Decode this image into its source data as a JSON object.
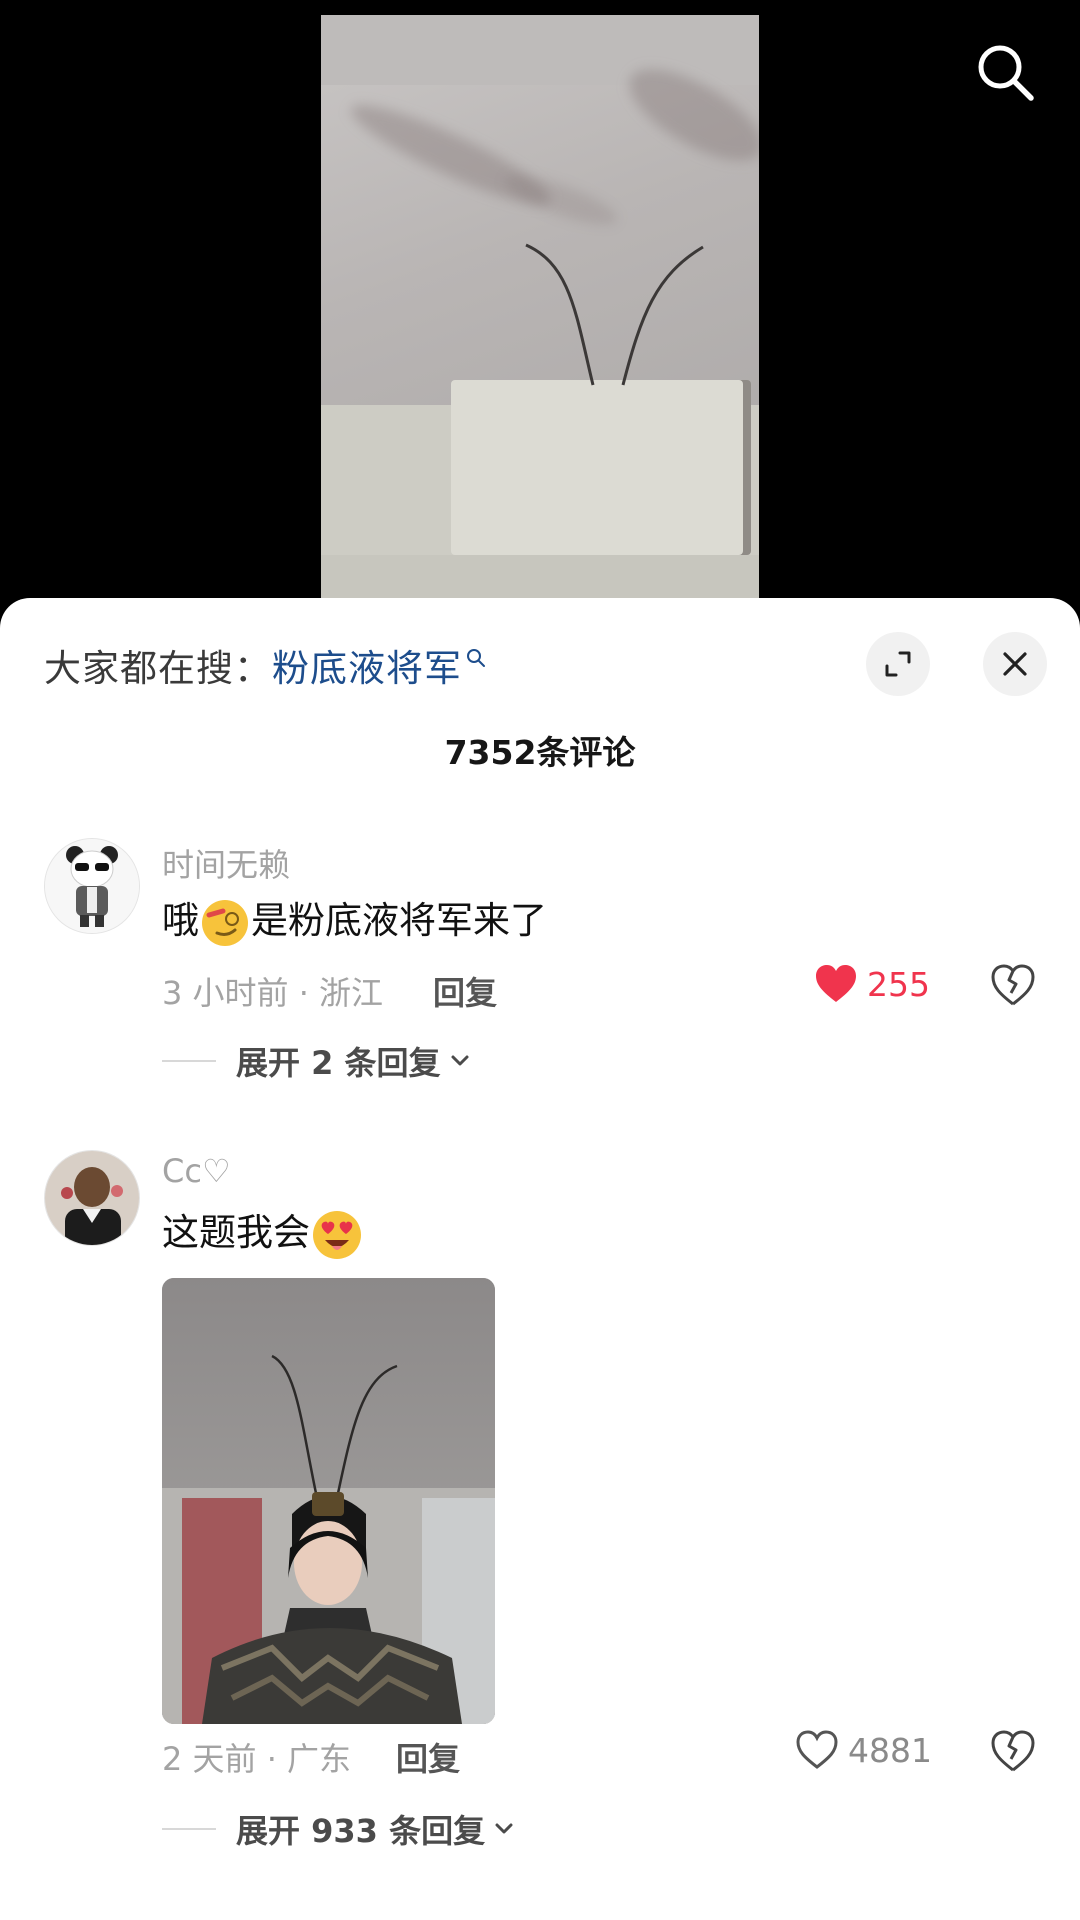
{
  "sheet": {
    "suggest_prefix": "大家都在搜：",
    "suggest_keyword": "粉底液将军",
    "comment_count": "7352条评论"
  },
  "comments": [
    {
      "username": "时间无赖",
      "text": "哦",
      "text_after": "是粉底液将军来了",
      "time_location": "3 小时前 · 浙江",
      "reply_label": "回复",
      "likes": "255",
      "liked": true,
      "expand_label": "展开 2 条回复"
    },
    {
      "username": "Cc♡",
      "text": "这题我会",
      "time_location": "2 天前 · 广东",
      "reply_label": "回复",
      "likes": "4881",
      "liked": false,
      "expand_label": "展开 933 条回复"
    }
  ],
  "colors": {
    "like_active": "#f0344d",
    "keyword_link": "#1d4d8c",
    "muted": "#a3a3a3"
  },
  "icons": [
    "search-icon",
    "expand-icon",
    "close-icon",
    "heart-icon",
    "heart-outline-icon",
    "broken-heart-icon",
    "chevron-down-icon",
    "smirk-emoji",
    "heart-eyes-emoji"
  ]
}
